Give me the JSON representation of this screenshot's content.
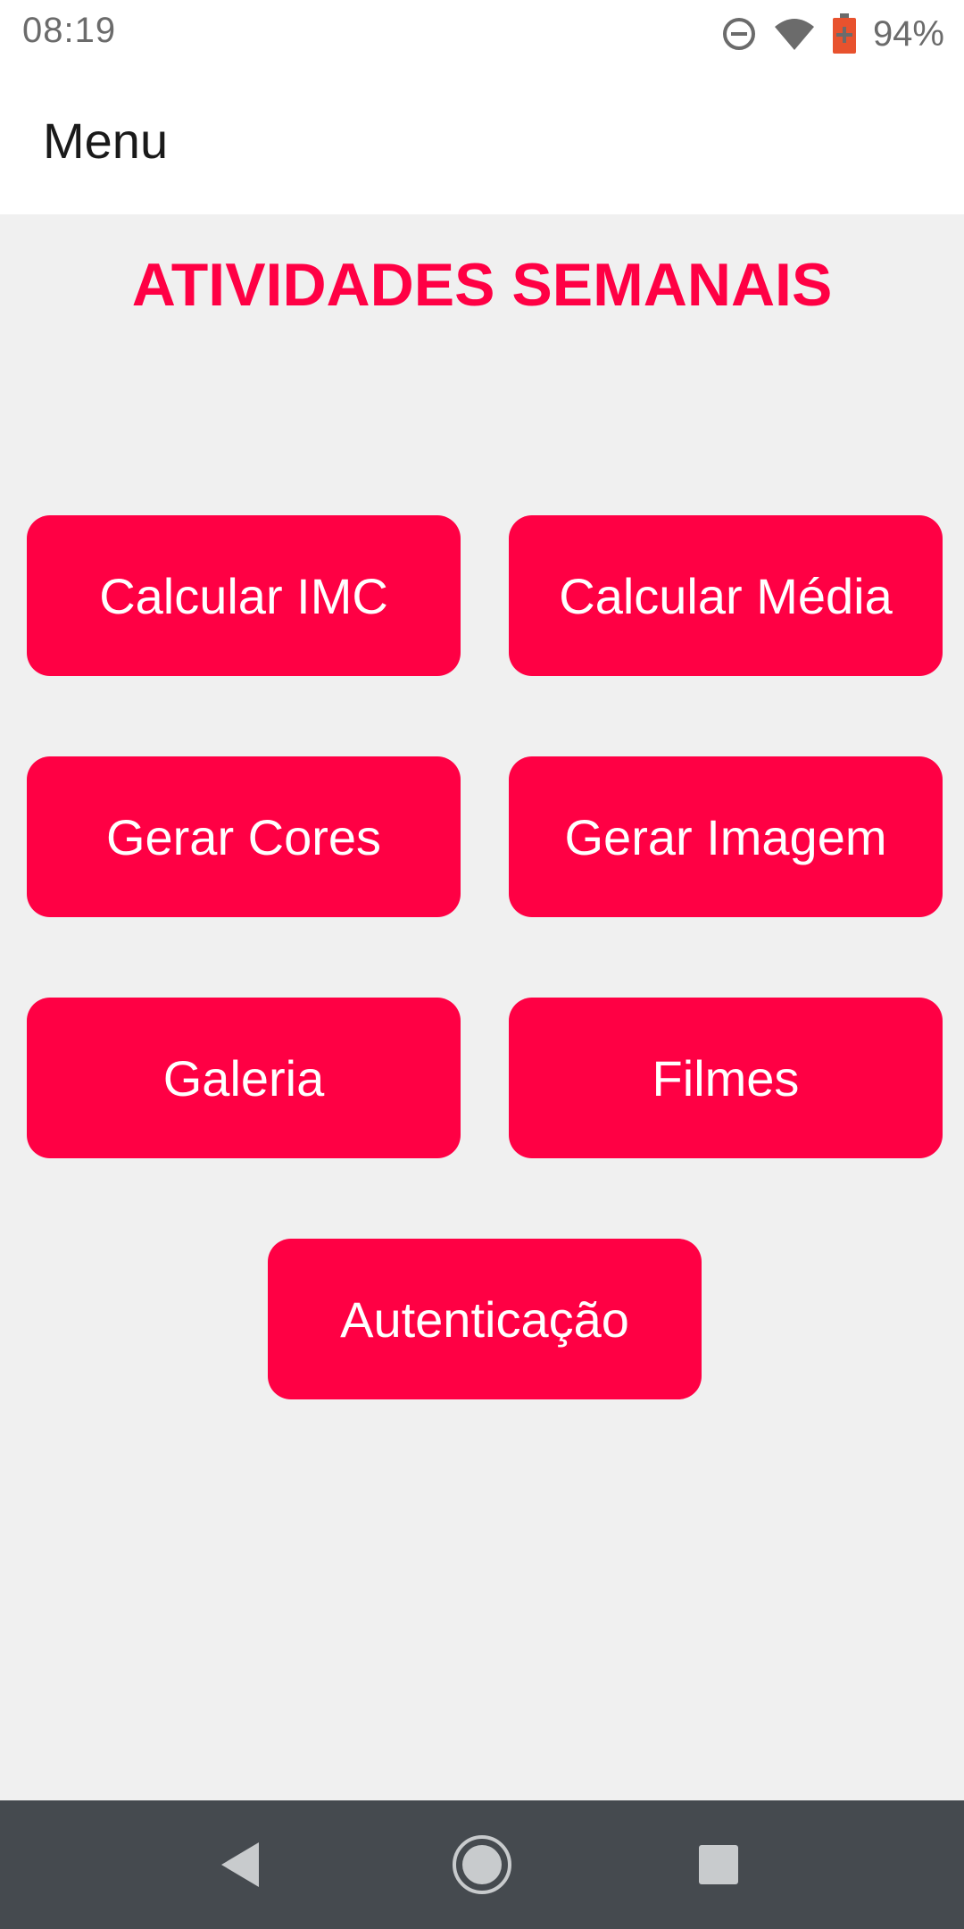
{
  "status_bar": {
    "time": "08:19",
    "battery_percent": "94%",
    "icons": [
      "do-not-disturb-icon",
      "wifi-icon",
      "battery-icon"
    ]
  },
  "app_bar": {
    "title": "Menu"
  },
  "content": {
    "heading": "ATIVIDADES SEMANAIS",
    "buttons": [
      {
        "label": "Calcular IMC"
      },
      {
        "label": "Calcular Média"
      },
      {
        "label": "Gerar Cores"
      },
      {
        "label": "Gerar Imagem"
      },
      {
        "label": "Galeria"
      },
      {
        "label": "Filmes"
      },
      {
        "label": "Autenticação"
      }
    ]
  },
  "nav_bar": {
    "icons": [
      "back-icon",
      "home-icon",
      "recent-apps-icon"
    ]
  },
  "colors": {
    "accent": "#ff0044",
    "background": "#f0f0f0",
    "app_bar": "#ffffff",
    "nav_bar": "#454a4f"
  }
}
